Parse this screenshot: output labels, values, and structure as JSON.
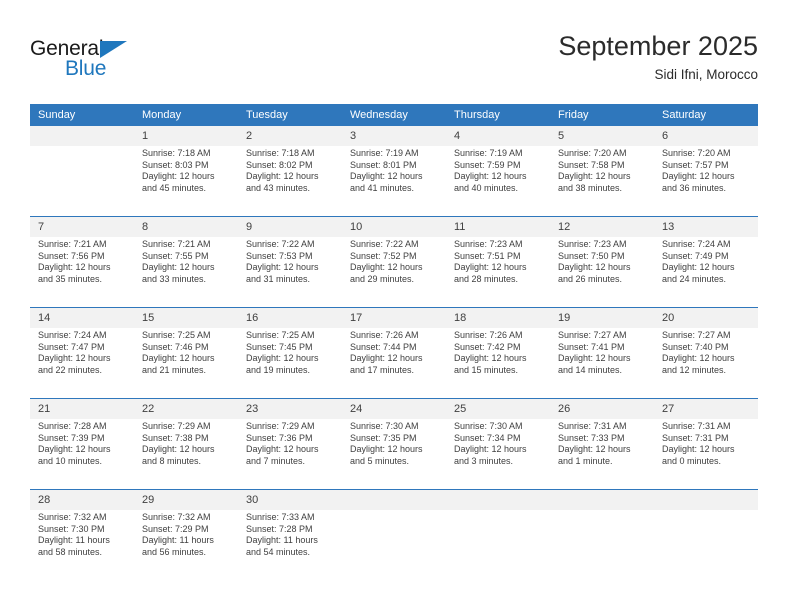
{
  "brand": {
    "name_primary": "General",
    "name_secondary": "Blue",
    "accent_color": "#1f77bd"
  },
  "header": {
    "title": "September 2025",
    "subtitle": "Sidi Ifni, Morocco"
  },
  "theme": {
    "header_blue": "#2f77bc",
    "daynum_gray": "#f2f2f2",
    "text_color": "#404040"
  },
  "weekday_headers": [
    "Sunday",
    "Monday",
    "Tuesday",
    "Wednesday",
    "Thursday",
    "Friday",
    "Saturday"
  ],
  "weeks": [
    {
      "days": [
        {
          "day": "",
          "sunrise": "",
          "sunset": "",
          "daylight_1": "",
          "daylight_2": ""
        },
        {
          "day": "1",
          "sunrise": "Sunrise: 7:18 AM",
          "sunset": "Sunset: 8:03 PM",
          "daylight_1": "Daylight: 12 hours",
          "daylight_2": "and 45 minutes."
        },
        {
          "day": "2",
          "sunrise": "Sunrise: 7:18 AM",
          "sunset": "Sunset: 8:02 PM",
          "daylight_1": "Daylight: 12 hours",
          "daylight_2": "and 43 minutes."
        },
        {
          "day": "3",
          "sunrise": "Sunrise: 7:19 AM",
          "sunset": "Sunset: 8:01 PM",
          "daylight_1": "Daylight: 12 hours",
          "daylight_2": "and 41 minutes."
        },
        {
          "day": "4",
          "sunrise": "Sunrise: 7:19 AM",
          "sunset": "Sunset: 7:59 PM",
          "daylight_1": "Daylight: 12 hours",
          "daylight_2": "and 40 minutes."
        },
        {
          "day": "5",
          "sunrise": "Sunrise: 7:20 AM",
          "sunset": "Sunset: 7:58 PM",
          "daylight_1": "Daylight: 12 hours",
          "daylight_2": "and 38 minutes."
        },
        {
          "day": "6",
          "sunrise": "Sunrise: 7:20 AM",
          "sunset": "Sunset: 7:57 PM",
          "daylight_1": "Daylight: 12 hours",
          "daylight_2": "and 36 minutes."
        }
      ]
    },
    {
      "days": [
        {
          "day": "7",
          "sunrise": "Sunrise: 7:21 AM",
          "sunset": "Sunset: 7:56 PM",
          "daylight_1": "Daylight: 12 hours",
          "daylight_2": "and 35 minutes."
        },
        {
          "day": "8",
          "sunrise": "Sunrise: 7:21 AM",
          "sunset": "Sunset: 7:55 PM",
          "daylight_1": "Daylight: 12 hours",
          "daylight_2": "and 33 minutes."
        },
        {
          "day": "9",
          "sunrise": "Sunrise: 7:22 AM",
          "sunset": "Sunset: 7:53 PM",
          "daylight_1": "Daylight: 12 hours",
          "daylight_2": "and 31 minutes."
        },
        {
          "day": "10",
          "sunrise": "Sunrise: 7:22 AM",
          "sunset": "Sunset: 7:52 PM",
          "daylight_1": "Daylight: 12 hours",
          "daylight_2": "and 29 minutes."
        },
        {
          "day": "11",
          "sunrise": "Sunrise: 7:23 AM",
          "sunset": "Sunset: 7:51 PM",
          "daylight_1": "Daylight: 12 hours",
          "daylight_2": "and 28 minutes."
        },
        {
          "day": "12",
          "sunrise": "Sunrise: 7:23 AM",
          "sunset": "Sunset: 7:50 PM",
          "daylight_1": "Daylight: 12 hours",
          "daylight_2": "and 26 minutes."
        },
        {
          "day": "13",
          "sunrise": "Sunrise: 7:24 AM",
          "sunset": "Sunset: 7:49 PM",
          "daylight_1": "Daylight: 12 hours",
          "daylight_2": "and 24 minutes."
        }
      ]
    },
    {
      "days": [
        {
          "day": "14",
          "sunrise": "Sunrise: 7:24 AM",
          "sunset": "Sunset: 7:47 PM",
          "daylight_1": "Daylight: 12 hours",
          "daylight_2": "and 22 minutes."
        },
        {
          "day": "15",
          "sunrise": "Sunrise: 7:25 AM",
          "sunset": "Sunset: 7:46 PM",
          "daylight_1": "Daylight: 12 hours",
          "daylight_2": "and 21 minutes."
        },
        {
          "day": "16",
          "sunrise": "Sunrise: 7:25 AM",
          "sunset": "Sunset: 7:45 PM",
          "daylight_1": "Daylight: 12 hours",
          "daylight_2": "and 19 minutes."
        },
        {
          "day": "17",
          "sunrise": "Sunrise: 7:26 AM",
          "sunset": "Sunset: 7:44 PM",
          "daylight_1": "Daylight: 12 hours",
          "daylight_2": "and 17 minutes."
        },
        {
          "day": "18",
          "sunrise": "Sunrise: 7:26 AM",
          "sunset": "Sunset: 7:42 PM",
          "daylight_1": "Daylight: 12 hours",
          "daylight_2": "and 15 minutes."
        },
        {
          "day": "19",
          "sunrise": "Sunrise: 7:27 AM",
          "sunset": "Sunset: 7:41 PM",
          "daylight_1": "Daylight: 12 hours",
          "daylight_2": "and 14 minutes."
        },
        {
          "day": "20",
          "sunrise": "Sunrise: 7:27 AM",
          "sunset": "Sunset: 7:40 PM",
          "daylight_1": "Daylight: 12 hours",
          "daylight_2": "and 12 minutes."
        }
      ]
    },
    {
      "days": [
        {
          "day": "21",
          "sunrise": "Sunrise: 7:28 AM",
          "sunset": "Sunset: 7:39 PM",
          "daylight_1": "Daylight: 12 hours",
          "daylight_2": "and 10 minutes."
        },
        {
          "day": "22",
          "sunrise": "Sunrise: 7:29 AM",
          "sunset": "Sunset: 7:38 PM",
          "daylight_1": "Daylight: 12 hours",
          "daylight_2": "and 8 minutes."
        },
        {
          "day": "23",
          "sunrise": "Sunrise: 7:29 AM",
          "sunset": "Sunset: 7:36 PM",
          "daylight_1": "Daylight: 12 hours",
          "daylight_2": "and 7 minutes."
        },
        {
          "day": "24",
          "sunrise": "Sunrise: 7:30 AM",
          "sunset": "Sunset: 7:35 PM",
          "daylight_1": "Daylight: 12 hours",
          "daylight_2": "and 5 minutes."
        },
        {
          "day": "25",
          "sunrise": "Sunrise: 7:30 AM",
          "sunset": "Sunset: 7:34 PM",
          "daylight_1": "Daylight: 12 hours",
          "daylight_2": "and 3 minutes."
        },
        {
          "day": "26",
          "sunrise": "Sunrise: 7:31 AM",
          "sunset": "Sunset: 7:33 PM",
          "daylight_1": "Daylight: 12 hours",
          "daylight_2": "and 1 minute."
        },
        {
          "day": "27",
          "sunrise": "Sunrise: 7:31 AM",
          "sunset": "Sunset: 7:31 PM",
          "daylight_1": "Daylight: 12 hours",
          "daylight_2": "and 0 minutes."
        }
      ]
    },
    {
      "days": [
        {
          "day": "28",
          "sunrise": "Sunrise: 7:32 AM",
          "sunset": "Sunset: 7:30 PM",
          "daylight_1": "Daylight: 11 hours",
          "daylight_2": "and 58 minutes."
        },
        {
          "day": "29",
          "sunrise": "Sunrise: 7:32 AM",
          "sunset": "Sunset: 7:29 PM",
          "daylight_1": "Daylight: 11 hours",
          "daylight_2": "and 56 minutes."
        },
        {
          "day": "30",
          "sunrise": "Sunrise: 7:33 AM",
          "sunset": "Sunset: 7:28 PM",
          "daylight_1": "Daylight: 11 hours",
          "daylight_2": "and 54 minutes."
        },
        {
          "day": "",
          "sunrise": "",
          "sunset": "",
          "daylight_1": "",
          "daylight_2": ""
        },
        {
          "day": "",
          "sunrise": "",
          "sunset": "",
          "daylight_1": "",
          "daylight_2": ""
        },
        {
          "day": "",
          "sunrise": "",
          "sunset": "",
          "daylight_1": "",
          "daylight_2": ""
        },
        {
          "day": "",
          "sunrise": "",
          "sunset": "",
          "daylight_1": "",
          "daylight_2": ""
        }
      ]
    }
  ]
}
